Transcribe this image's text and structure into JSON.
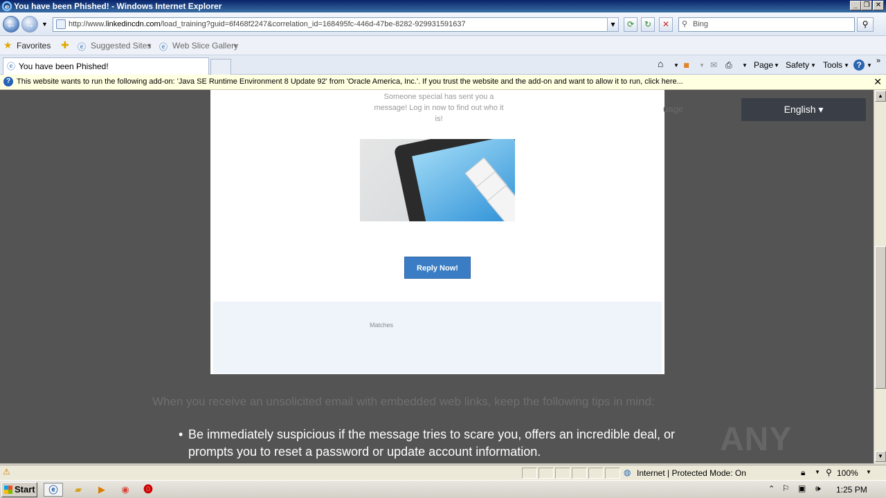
{
  "window": {
    "title": "You have been Phished! - Windows Internet Explorer"
  },
  "address": {
    "url_prefix": "http://www.",
    "url_host": "linkedincdn.com",
    "url_path": "/load_training?guid=6f468f2247&correlation_id=168495fc-446d-47be-8282-929931591637",
    "search_placeholder": "Bing"
  },
  "favorites": {
    "favorites_label": "Favorites",
    "suggested_label": "Suggested Sites",
    "slice_label": "Web Slice Gallery"
  },
  "tab": {
    "label": "You have been Phished!"
  },
  "commands": {
    "page": "Page",
    "safety": "Safety",
    "tools": "Tools"
  },
  "infobar": {
    "message": "This website wants to run the following add-on: 'Java SE Runtime Environment 8 Update 92' from 'Oracle America, Inc.'. If you trust the website and the add-on and want to allow it to run, click here..."
  },
  "content": {
    "lead_text": "Someone special has sent you a message! Log in now to find out who it is!",
    "reply_label": "Reply Now!",
    "matches_label": "Matches",
    "language_partial": "uage",
    "language_button": "English ▾",
    "tip_heading": "When you receive an unsolicited email with embedded web links, keep the following tips in mind:",
    "bullet_text": "Be immediately suspicious if the message tries to scare you, offers an incredible deal, or prompts you to reset a password or update account information.",
    "watermark": "ANY RUN"
  },
  "status": {
    "zone_text": "Internet | Protected Mode: On",
    "zoom": "100%"
  },
  "taskbar": {
    "start_label": "Start",
    "clock": "1:25 PM"
  }
}
